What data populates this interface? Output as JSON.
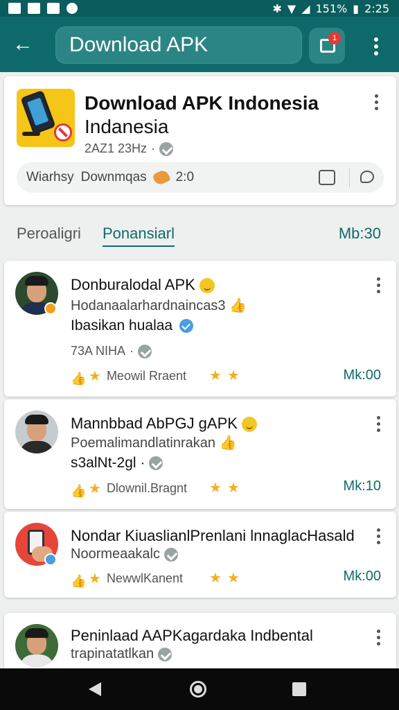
{
  "status_bar": {
    "battery": "151%",
    "time": "2:25"
  },
  "app_bar": {
    "title": "Download APK",
    "notification_count": "1"
  },
  "app_card": {
    "title_line1": "Download APK Indonesia",
    "title_line2": "Indanesia",
    "meta": "2AZ1 23Hz",
    "info_left": "Wiarhsy",
    "info_mid": "Downmqas",
    "info_value": "2:0"
  },
  "tabs": {
    "tab1": "Peroaligri",
    "tab2": "Ponansiarl",
    "right_label": "Mb:30"
  },
  "posts": [
    {
      "name": "Donburalodal APK",
      "subtitle": "Hodanaalarhardnaincas",
      "subtitle_suffix": "3",
      "line": "Ibasikan hualaa",
      "meta": "73A NIHA",
      "action_label": "Meowil Rraent",
      "count": "Mk:00"
    },
    {
      "name": "Mannbbad AbPGJ gAPK",
      "subtitle": "Poemalimandlatinrakan",
      "line": "s3alNt-2gl",
      "action_label": "Dlownil.Bragnt",
      "count": "Mk:10"
    },
    {
      "name": "Nondar KiuaslianlPrenlani lnnaglacHasald",
      "subtitle": "Noormeaakalc",
      "action_label": "NewwlKanent",
      "count": "Mk:00"
    },
    {
      "name": "Peninlaad AAPKagardaka Indbental",
      "subtitle": "trapinatatlkan"
    }
  ],
  "colors": {
    "primary": "#0e6a6a",
    "primary_light": "#2c8585",
    "star": "#f2b01e",
    "badge": "#e53935"
  }
}
